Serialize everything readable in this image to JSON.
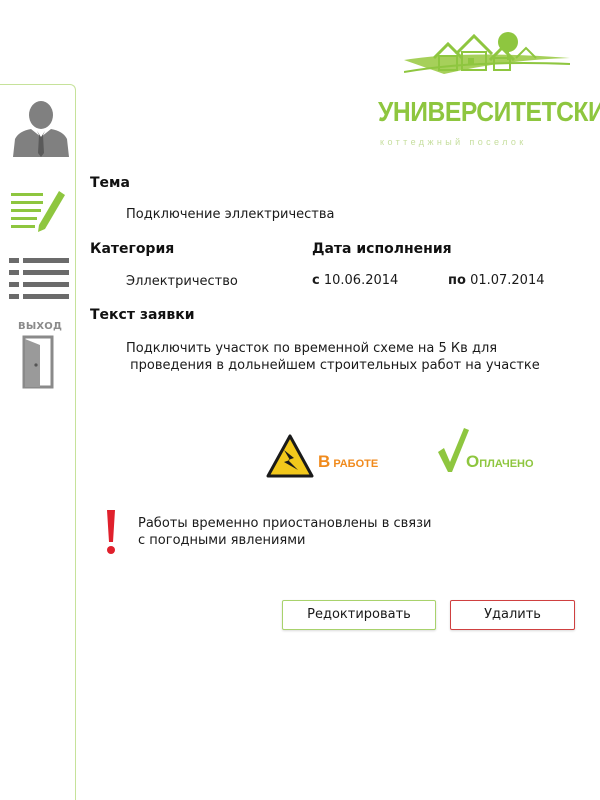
{
  "logo": {
    "title": "УНИВЕРСИТЕТСКИЙ",
    "subtitle": "коттеджный поселок",
    "brand_color": "#8ec63f"
  },
  "sidebar": {
    "items": [
      {
        "icon": "user-icon"
      },
      {
        "icon": "edit-icon"
      },
      {
        "icon": "list-icon"
      },
      {
        "icon": "exit-door-icon",
        "label": "ВЫХОД"
      }
    ]
  },
  "request": {
    "topic_label": "Тема",
    "topic_value": "Подключение эллектричества",
    "category_label": "Категория",
    "category_value": "Эллектричество",
    "date_label": "Дата исполнения",
    "date_from_prefix": "с",
    "date_from": "10.06.2014",
    "date_to_prefix": "по",
    "date_to": "01.07.2014",
    "text_label": "Текст заявки",
    "text_line1": "Подключить участок по временной схеме  на 5 Кв для",
    "text_line2": " проведения в дольнейшем строительных работ на участке"
  },
  "status": {
    "work_first": "В",
    "work_rest": "РАБОТЕ",
    "work_color": "#f08a1c",
    "paid_first": "О",
    "paid_rest": "ПЛАЧЕНО",
    "paid_color": "#8ec63f"
  },
  "notice": {
    "line1": "Работы временно приостановлены в связи",
    "line2": "с погодными явлениями",
    "icon": "exclamation-icon",
    "color": "#e0202c"
  },
  "actions": {
    "edit_label": "Редоктировать",
    "delete_label": "Удалить"
  }
}
